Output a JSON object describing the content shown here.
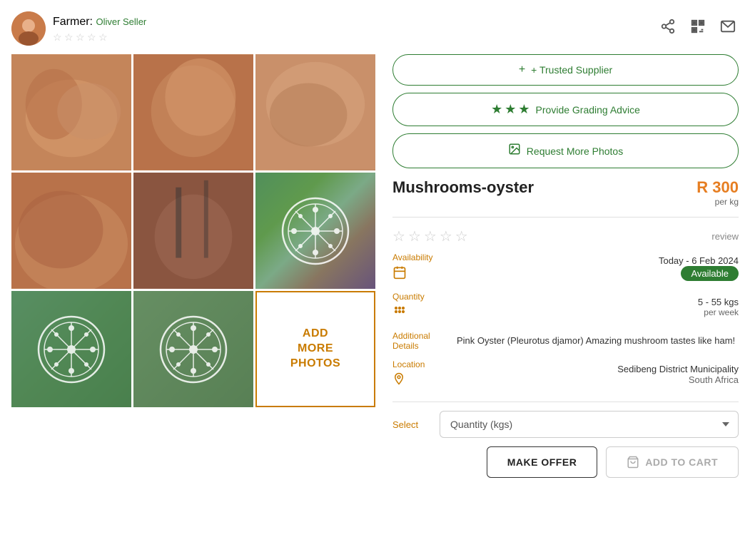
{
  "farmer": {
    "label": "Farmer:",
    "name": "Oliver Seller",
    "avatar_alt": "farmer avatar"
  },
  "header": {
    "share_icon": "share-icon",
    "qr_icon": "qr-icon",
    "mail_icon": "mail-icon"
  },
  "action_buttons": {
    "trusted_supplier": "+ Trusted Supplier",
    "grading_advice": "Provide Grading Advice",
    "request_photos": "Request More Photos"
  },
  "product": {
    "name": "Mushrooms-oyster",
    "price": "R 300",
    "per_kg": "per kg",
    "review": "review"
  },
  "availability": {
    "label": "Availability",
    "date": "Today - 6 Feb 2024",
    "status": "Available"
  },
  "quantity": {
    "label": "Quantity",
    "value": "5 - 55 kgs",
    "period": "per week"
  },
  "additional": {
    "label": "Additional Details",
    "text": "Pink Oyster (Pleurotus djamor) Amazing mushroom tastes like ham!"
  },
  "location": {
    "label": "Location",
    "name": "Sedibeng District Municipality",
    "country": "South Africa"
  },
  "select": {
    "label": "Select",
    "placeholder": "Quantity (kgs)"
  },
  "buttons": {
    "make_offer": "MAKE OFFER",
    "add_to_cart": "ADD TO CART"
  },
  "add_photos": {
    "line1": "ADD",
    "line2": "MORE",
    "line3": "PHOTOS"
  }
}
